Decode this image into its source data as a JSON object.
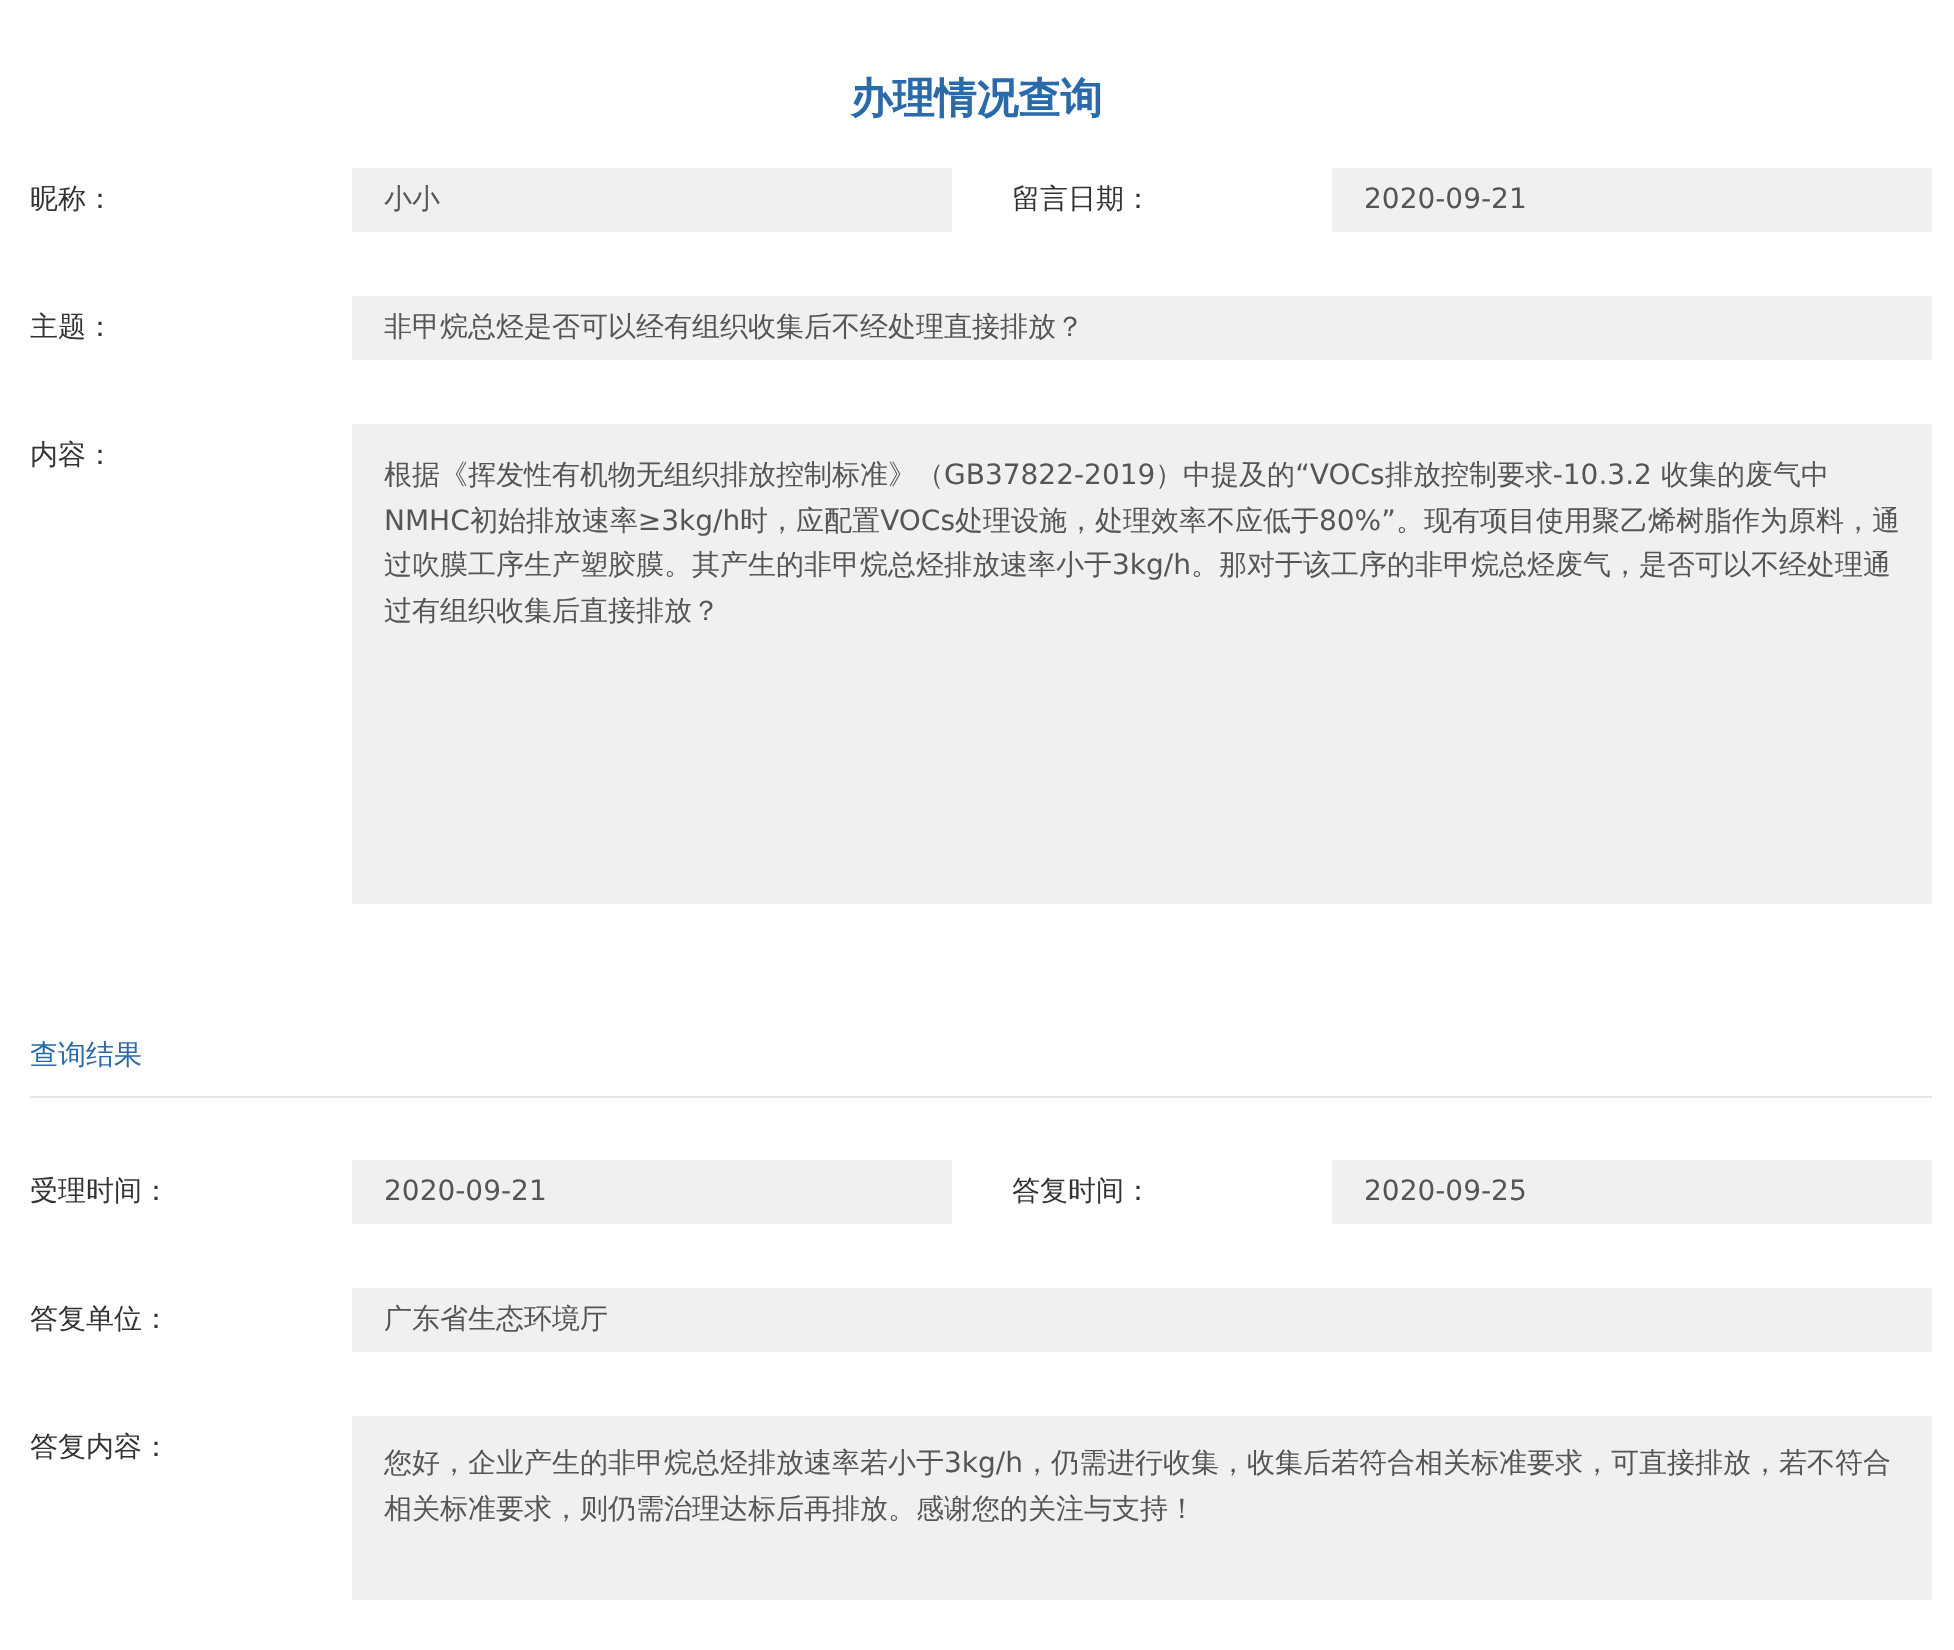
{
  "title": "办理情况查询",
  "query_rows": [
    {
      "kind": "pair",
      "fields": [
        {
          "label": "昵称：",
          "value": "小小"
        },
        {
          "label": "留言日期：",
          "value": "2020-09-21"
        }
      ]
    },
    {
      "kind": "single",
      "fields": [
        {
          "label": "主题：",
          "value": "非甲烷总烃是否可以经有组织收集后不经处理直接排放？"
        }
      ]
    },
    {
      "kind": "text",
      "fields": [
        {
          "label": "内容：",
          "value": "根据《挥发性有机物无组织排放控制标准》（GB37822-2019）中提及的“VOCs排放控制要求-10.3.2 收集的废气中NMHC初始排放速率≥3kg/h时，应配置VOCs处理设施，处理效率不应低于80%”。现有项目使用聚乙烯树脂作为原料，通过吹膜工序生产塑胶膜。其产生的非甲烷总烃排放速率小于3kg/h。那对于该工序的非甲烷总烃废气，是否可以不经处理通过有组织收集后直接排放？"
        }
      ]
    }
  ],
  "result_heading": "查询结果",
  "result_rows": [
    {
      "kind": "pair",
      "fields": [
        {
          "label": "受理时间：",
          "value": "2020-09-21"
        },
        {
          "label": "答复时间：",
          "value": "2020-09-25"
        }
      ]
    },
    {
      "kind": "single",
      "fields": [
        {
          "label": "答复单位：",
          "value": "广东省生态环境厅"
        }
      ]
    },
    {
      "kind": "reply",
      "fields": [
        {
          "label": "答复内容：",
          "value": "您好，企业产生的非甲烷总烃排放速率若小于3kg/h，仍需进行收集，收集后若符合相关标准要求，可直接排放，若不符合相关标准要求，则仍需治理达标后再排放。感谢您的关注与支持！"
        }
      ]
    }
  ]
}
